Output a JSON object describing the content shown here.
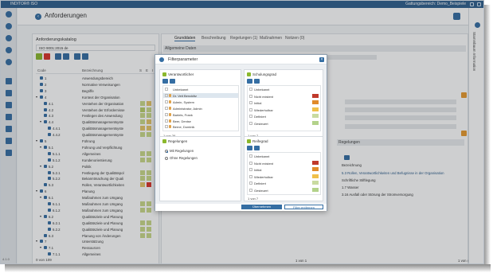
{
  "app": {
    "title": "INDITOR® ISO",
    "workspace": "Gattungsbereich: Demo_Beispiele",
    "version": "4.1.0"
  },
  "header": {
    "title": "Anforderungen"
  },
  "sidebar": {
    "label": "Stammbaum Information"
  },
  "tree": {
    "title": "Anforderungskatalog",
    "catalog": "ISO 9001:2015 de",
    "columns": [
      "Code",
      "Bezeichnung",
      "S",
      "E",
      "I"
    ],
    "count": "0 von 109",
    "rows": [
      {
        "code": "1",
        "name": "Anwendungsbereich",
        "level": 0,
        "exp": "",
        "sq": []
      },
      {
        "code": "2",
        "name": "Normative Verweisungen",
        "level": 0,
        "exp": "",
        "sq": []
      },
      {
        "code": "3",
        "name": "Begriffe",
        "level": 0,
        "exp": "",
        "sq": []
      },
      {
        "code": "4",
        "name": "Kontext der Organisation",
        "level": 0,
        "exp": "▾",
        "sq": []
      },
      {
        "code": "4.1",
        "name": "Verstehen der Organisation",
        "level": 1,
        "exp": "",
        "sq": [
          "#c9d98a",
          "#e5c66a"
        ]
      },
      {
        "code": "4.2",
        "name": "Verstehen der Erfordernisse",
        "level": 1,
        "exp": "",
        "sq": [
          "#b9cf6b",
          "#c9d98a"
        ]
      },
      {
        "code": "4.3",
        "name": "Festlegen des Anwendung",
        "level": 1,
        "exp": "",
        "sq": [
          "#c9d98a",
          "#c9d98a"
        ]
      },
      {
        "code": "4.4",
        "name": "Qualitätsmanagementsyste",
        "level": 1,
        "exp": "▾",
        "sq": [
          "#c9d98a",
          "#e5c66a"
        ]
      },
      {
        "code": "4.4.1",
        "name": "Qualitätsmanagementsyste",
        "level": 2,
        "exp": "",
        "sq": [
          "#e5c66a",
          "#e5c66a"
        ]
      },
      {
        "code": "4.4.2",
        "name": "Qualitätsmanagementsyste",
        "level": 2,
        "exp": "",
        "sq": [
          "#c9d98a",
          "#c9d98a"
        ]
      },
      {
        "code": "5",
        "name": "Führung",
        "level": 0,
        "exp": "▾",
        "sq": []
      },
      {
        "code": "5.1",
        "name": "Führung und Verpflichtung",
        "level": 1,
        "exp": "▾",
        "sq": []
      },
      {
        "code": "5.1.1",
        "name": "Allgemeines",
        "level": 2,
        "exp": "",
        "sq": [
          "#c9d98a",
          "#c9d98a"
        ]
      },
      {
        "code": "5.1.2",
        "name": "Kundenorientierung",
        "level": 2,
        "exp": "",
        "sq": [
          "#c9d98a",
          "#c9d98a"
        ]
      },
      {
        "code": "5.2",
        "name": "Politik",
        "level": 1,
        "exp": "▾",
        "sq": []
      },
      {
        "code": "5.2.1",
        "name": "Festlegung der Qualitätspol",
        "level": 2,
        "exp": "",
        "sq": [
          "#c9d98a",
          "#c9d98a"
        ]
      },
      {
        "code": "5.2.2",
        "name": "Bekanntmachung der Quali",
        "level": 2,
        "exp": "",
        "sq": [
          "#c9d98a",
          "#c9d98a"
        ]
      },
      {
        "code": "5.3",
        "name": "Rollen, Verantwortlichkeiten",
        "level": 1,
        "exp": "",
        "sq": [
          "#e5c66a",
          "#d9352b"
        ]
      },
      {
        "code": "6",
        "name": "Planung",
        "level": 0,
        "exp": "▾",
        "sq": []
      },
      {
        "code": "6.1",
        "name": "Maßnahmen zum Umgang",
        "level": 1,
        "exp": "▾",
        "sq": []
      },
      {
        "code": "6.1.1",
        "name": "Maßnahmen zum Umgang",
        "level": 2,
        "exp": "",
        "sq": [
          "#c9d98a",
          "#c9d98a"
        ]
      },
      {
        "code": "6.1.2",
        "name": "Maßnahmen zum Umgang",
        "level": 2,
        "exp": "",
        "sq": [
          "#c9d98a",
          "#c9d98a"
        ]
      },
      {
        "code": "6.2",
        "name": "Qualitätsziele und Planung",
        "level": 1,
        "exp": "▾",
        "sq": []
      },
      {
        "code": "6.2.1",
        "name": "Qualitätsziele und Planung",
        "level": 2,
        "exp": "",
        "sq": [
          "#c9d98a",
          "#c9d98a"
        ]
      },
      {
        "code": "6.2.2",
        "name": "Qualitätsziele und Planung",
        "level": 2,
        "exp": "",
        "sq": [
          "#c9d98a",
          "#c9d98a"
        ]
      },
      {
        "code": "6.3",
        "name": "Planung von Änderungen",
        "level": 1,
        "exp": "",
        "sq": [
          "#c9d98a",
          "#c9d98a"
        ]
      },
      {
        "code": "7",
        "name": "Unterstützung",
        "level": 0,
        "exp": "▾",
        "sq": []
      },
      {
        "code": "7.1",
        "name": "Ressourcen",
        "level": 1,
        "exp": "▾",
        "sq": []
      },
      {
        "code": "7.1.1",
        "name": "Allgemeines",
        "level": 2,
        "exp": "",
        "sq": []
      }
    ]
  },
  "main": {
    "tabs": [
      "Grunddaten",
      "Beschreibung",
      "Regelungen (1)",
      "Maßnahmen",
      "Notizen (0)"
    ],
    "section1": "Allgemeine Daten",
    "section2": "Regelungen",
    "reg_header": "Bezeichnung",
    "reg_rows": [
      "5.3 Rollen, Verantwortlichkeiten und Befugnisse in der Organisation",
      "Schriftliche Stiftlegung",
      "1.7 Wasser",
      "3.16 Ausfall oder Störung der Stromversorgung"
    ],
    "count_left": "1 von 1",
    "count_right": "1 von 4"
  },
  "modal": {
    "title": "Filterparameter",
    "apply": "Übernehmen",
    "clear": "Filter entfernen",
    "responsible": {
      "title": "Verantwortlicher",
      "count": "1 von 26",
      "items": [
        "Unbekannt",
        "Dr. Veit Bencklitz",
        "Admin, System",
        "Administrator, Admin",
        "Bartels, Frank",
        "Beer, Denise",
        "Berne, Dominik"
      ]
    },
    "training": {
      "title": "Schulungsgrad",
      "count": "1 von 7",
      "items": [
        {
          "name": "Unbekannt",
          "color": ""
        },
        {
          "name": "Nicht existent",
          "color": "#c0392b"
        },
        {
          "name": "Initial",
          "color": "#e08a2a"
        },
        {
          "name": "Wiederholbar",
          "color": "#f0c04a"
        },
        {
          "name": "Definiert",
          "color": "#c9dba0"
        },
        {
          "name": "Gesteuert",
          "color": "#b3d28a"
        }
      ]
    },
    "regulations": {
      "title": "Regelungen",
      "options": [
        "Mit Regelungen",
        "Ohne Regelungen"
      ]
    },
    "maturity": {
      "title": "Reifegrad",
      "count": "1 von 7",
      "items": [
        {
          "name": "Unbekannt",
          "color": ""
        },
        {
          "name": "Nicht existent",
          "color": "#c0392b"
        },
        {
          "name": "Initial",
          "color": "#e08a2a"
        },
        {
          "name": "Wiederholbar",
          "color": "#f0c04a"
        },
        {
          "name": "Definiert",
          "color": "#c9dba0"
        },
        {
          "name": "Gesteuert",
          "color": "#b3d28a"
        }
      ]
    }
  }
}
